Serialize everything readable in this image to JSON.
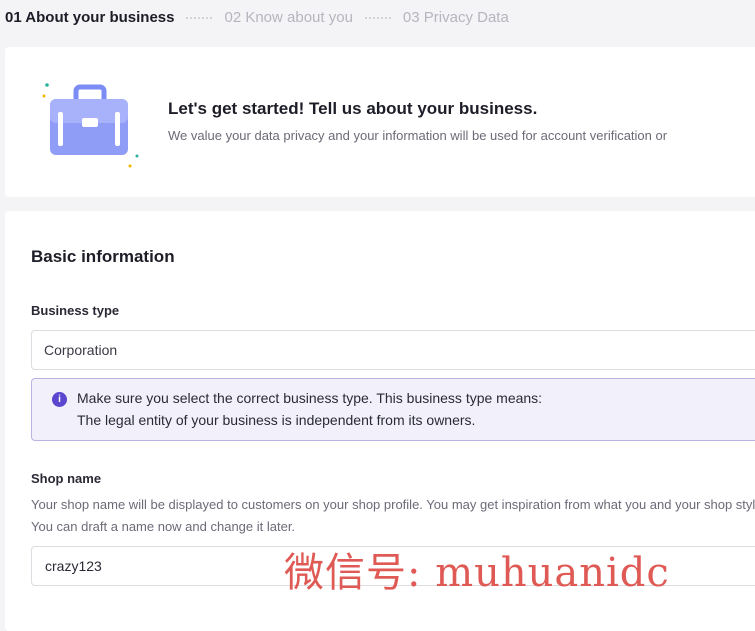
{
  "stepper": {
    "steps": [
      {
        "label": "01 About your business",
        "active": true
      },
      {
        "label": "02 Know about you",
        "active": false
      },
      {
        "label": "03 Privacy Data",
        "active": false
      }
    ]
  },
  "hero": {
    "icon": "briefcase-icon",
    "title": "Let's get started! Tell us about your business.",
    "subtitle": "We value your data privacy and your information will be used for account verification or"
  },
  "basic_info": {
    "section_title": "Basic information",
    "business_type": {
      "label": "Business type",
      "value": "Corporation"
    },
    "notice": {
      "icon": "info-icon",
      "line1": "Make sure you select the correct business type. This business type means:",
      "line2": "The legal entity of your business is independent from its owners."
    },
    "shop_name": {
      "label": "Shop name",
      "help": "Your shop name will be displayed to customers on your shop profile. You may get inspiration from what you and your shop style. You can draft a name now and change it later.",
      "value": "crazy123"
    }
  },
  "watermark": "微信号: muhuanidc",
  "colors": {
    "accent": "#5a46cf",
    "notice_bg": "#f2f1fb",
    "notice_border": "#b9b3e6",
    "watermark": "#e05a55"
  }
}
